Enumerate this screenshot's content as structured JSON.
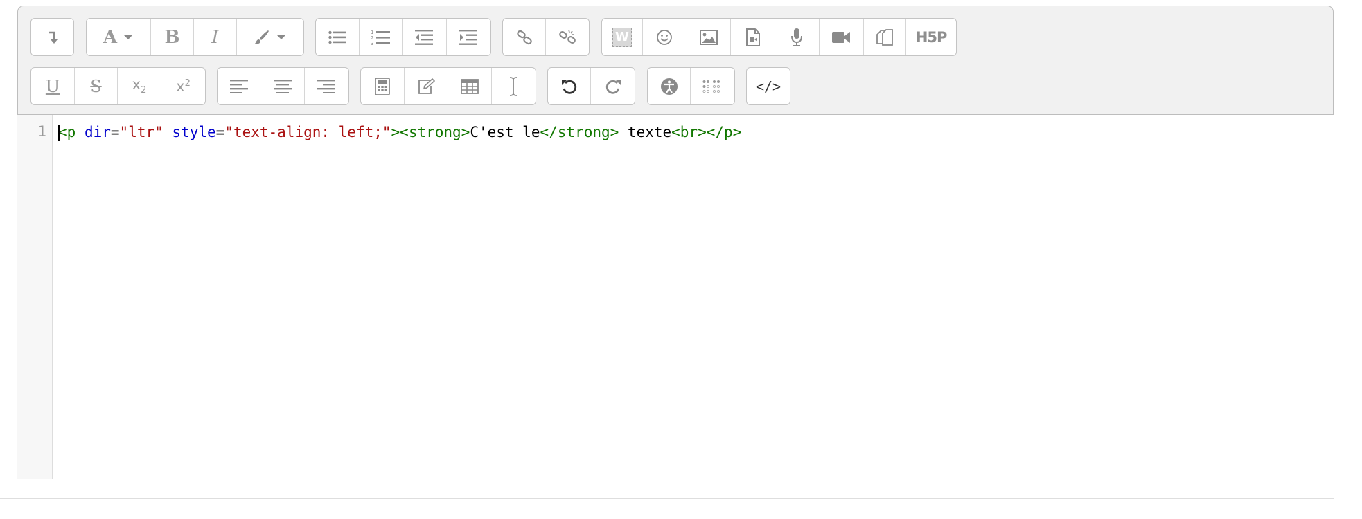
{
  "toolbar": {
    "colors": {
      "icon": "#8a8a8a",
      "icon_dark": "#333333",
      "panel_bg": "#f1f1f1"
    },
    "row1": [
      {
        "group": "collapse",
        "buttons": [
          {
            "name": "toolbar-toggle",
            "icon": "arrow-down-icon"
          }
        ]
      },
      {
        "group": "style",
        "buttons": [
          {
            "name": "font-style",
            "icon": "font-icon",
            "label": "A"
          },
          {
            "name": "bold",
            "icon": "bold-icon",
            "label": "B"
          },
          {
            "name": "italic",
            "icon": "italic-icon",
            "label": "I"
          },
          {
            "name": "text-color",
            "icon": "paintbrush-icon"
          }
        ]
      },
      {
        "group": "lists",
        "buttons": [
          {
            "name": "unordered-list",
            "icon": "bullet-list-icon"
          },
          {
            "name": "ordered-list",
            "icon": "numbered-list-icon"
          },
          {
            "name": "outdent",
            "icon": "outdent-icon"
          },
          {
            "name": "indent",
            "icon": "indent-icon"
          }
        ]
      },
      {
        "group": "links",
        "buttons": [
          {
            "name": "link",
            "icon": "link-icon"
          },
          {
            "name": "unlink",
            "icon": "unlink-icon"
          }
        ]
      },
      {
        "group": "insert",
        "buttons": [
          {
            "name": "wiki-link",
            "icon": "wiki-icon",
            "label": "W"
          },
          {
            "name": "emoji",
            "icon": "smiley-icon"
          },
          {
            "name": "image",
            "icon": "image-icon"
          },
          {
            "name": "media",
            "icon": "file-video-icon"
          },
          {
            "name": "record-audio",
            "icon": "microphone-icon"
          },
          {
            "name": "record-video",
            "icon": "video-camera-icon"
          },
          {
            "name": "manage-files",
            "icon": "files-icon"
          },
          {
            "name": "h5p",
            "icon": "h5p-icon",
            "label": "H5P"
          }
        ]
      }
    ],
    "row2": [
      {
        "group": "font-decoration",
        "buttons": [
          {
            "name": "underline",
            "icon": "underline-icon",
            "label": "U"
          },
          {
            "name": "strikethrough",
            "icon": "strikethrough-icon",
            "label": "S"
          },
          {
            "name": "subscript",
            "icon": "subscript-icon",
            "label": "x",
            "sub": "2"
          },
          {
            "name": "superscript",
            "icon": "superscript-icon",
            "label": "x",
            "sup": "2"
          }
        ]
      },
      {
        "group": "align",
        "buttons": [
          {
            "name": "align-left",
            "icon": "align-left-icon"
          },
          {
            "name": "align-center",
            "icon": "align-center-icon"
          },
          {
            "name": "align-right",
            "icon": "align-right-icon"
          }
        ]
      },
      {
        "group": "insert-extra",
        "buttons": [
          {
            "name": "equation",
            "icon": "calculator-icon"
          },
          {
            "name": "special-character",
            "icon": "edit-icon"
          },
          {
            "name": "table",
            "icon": "table-icon"
          },
          {
            "name": "clear-formatting",
            "icon": "text-cursor-icon"
          }
        ]
      },
      {
        "group": "undo",
        "buttons": [
          {
            "name": "undo",
            "icon": "undo-icon"
          },
          {
            "name": "redo",
            "icon": "redo-icon"
          }
        ]
      },
      {
        "group": "accessibility",
        "buttons": [
          {
            "name": "accessibility-checker",
            "icon": "accessibility-icon"
          },
          {
            "name": "screenreader-helper",
            "icon": "braille-icon"
          }
        ]
      },
      {
        "group": "other",
        "buttons": [
          {
            "name": "html-source",
            "icon": "code-icon",
            "label": "</>"
          }
        ]
      }
    ]
  },
  "editor": {
    "line_number": "1",
    "code": {
      "tag_open_p": "<p",
      "attr_dir": "dir",
      "eq1": "=",
      "val_dir": "\"ltr\"",
      "attr_style": "style",
      "eq2": "=",
      "val_style": "\"text-align: left;\"",
      "tag_close_start": ">",
      "tag_strong_open": "<strong>",
      "text_bold": "C'est le",
      "tag_strong_close": "</strong>",
      "text_plain": " texte",
      "tag_br": "<br>",
      "tag_p_close": "</p>"
    }
  }
}
